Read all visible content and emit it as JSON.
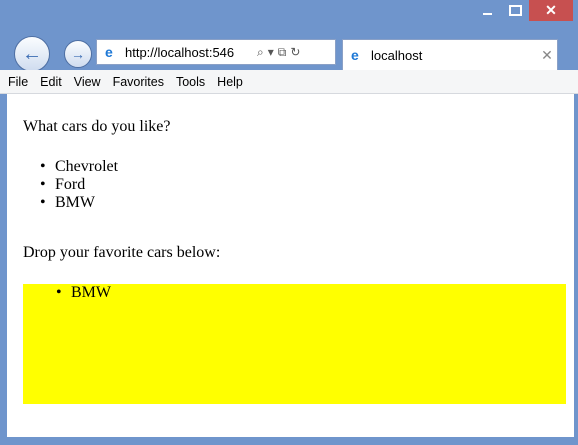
{
  "browser": {
    "address": "http://localhost:546",
    "tab_title": "localhost",
    "menu": [
      "File",
      "Edit",
      "View",
      "Favorites",
      "Tools",
      "Help"
    ]
  },
  "page": {
    "question": "What cars do you like?",
    "cars": [
      "Chevrolet",
      "Ford",
      "BMW"
    ],
    "drop_label": "Drop your favorite cars below:",
    "favorites": [
      "BMW"
    ],
    "drop_zone_color": "#ffff00"
  },
  "icons": {
    "back": "back-arrow-icon",
    "forward": "forward-arrow-icon",
    "ie": "internet-explorer-icon",
    "search": "search-icon",
    "refresh": "refresh-icon"
  }
}
